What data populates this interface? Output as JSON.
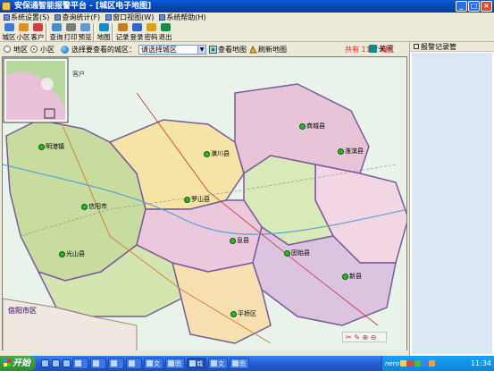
{
  "window": {
    "title": "安保通智能报警平台 - [城区电子地图]",
    "min": "_",
    "max": "□",
    "close": "×"
  },
  "menu": [
    {
      "label": "系统设置(S)",
      "icon": "settings-icon"
    },
    {
      "label": "查询统计(F)",
      "icon": "query-icon"
    },
    {
      "label": "窗口视图(W)",
      "icon": "window-icon"
    },
    {
      "label": "系统帮助(H)",
      "icon": "help-icon"
    }
  ],
  "toolbar": [
    {
      "label": "城区",
      "icon": "city-icon",
      "color": "#3a7bd5"
    },
    {
      "label": "小区",
      "icon": "community-icon",
      "color": "#e09020"
    },
    {
      "label": "客户",
      "icon": "customer-icon",
      "color": "#d04040"
    },
    {
      "sep": true
    },
    {
      "label": "查询",
      "icon": "search-icon",
      "color": "#4090d0"
    },
    {
      "label": "打印",
      "icon": "print-icon",
      "color": "#7a7a7a"
    },
    {
      "label": "预览",
      "icon": "preview-icon",
      "color": "#5a9ad8"
    },
    {
      "sep": true
    },
    {
      "label": "地图",
      "icon": "map-icon",
      "color": "#1a8ac0"
    },
    {
      "sep": true
    },
    {
      "label": "记录",
      "icon": "record-icon",
      "color": "#c08020"
    },
    {
      "label": "登录",
      "icon": "login-icon",
      "color": "#2a6ac8"
    },
    {
      "label": "密码",
      "icon": "password-icon",
      "color": "#d8a020"
    },
    {
      "label": "退出",
      "icon": "exit-icon",
      "color": "#1a8a4a"
    }
  ],
  "filter": {
    "radio_district": "地区",
    "radio_community": "小区",
    "select_label": "选择要查看的城区：",
    "select_value": "请选择城区",
    "view_map": "查看地图",
    "refresh_map": "刷新地图",
    "count_text": "共有 11 个城区",
    "close_label": "关闭"
  },
  "alarm_panel": {
    "title": "报警记录管"
  },
  "map": {
    "towns": [
      {
        "name": "明港镇"
      },
      {
        "name": "潢川县"
      },
      {
        "name": "商城县"
      },
      {
        "name": "淮滨县"
      },
      {
        "name": "信阳市"
      },
      {
        "name": "罗山县"
      },
      {
        "name": "息县"
      },
      {
        "name": "固始县"
      },
      {
        "name": "光山县"
      },
      {
        "name": "新县"
      },
      {
        "name": "平桥区"
      }
    ],
    "overview_label": "客户",
    "corner_label": "信阳市区"
  },
  "taskbar": {
    "start": "开始",
    "tasks": [
      "",
      "",
      "",
      "",
      "文",
      "图",
      "城",
      "文",
      "图"
    ],
    "tray_text": "nero",
    "clock": "11:34"
  }
}
